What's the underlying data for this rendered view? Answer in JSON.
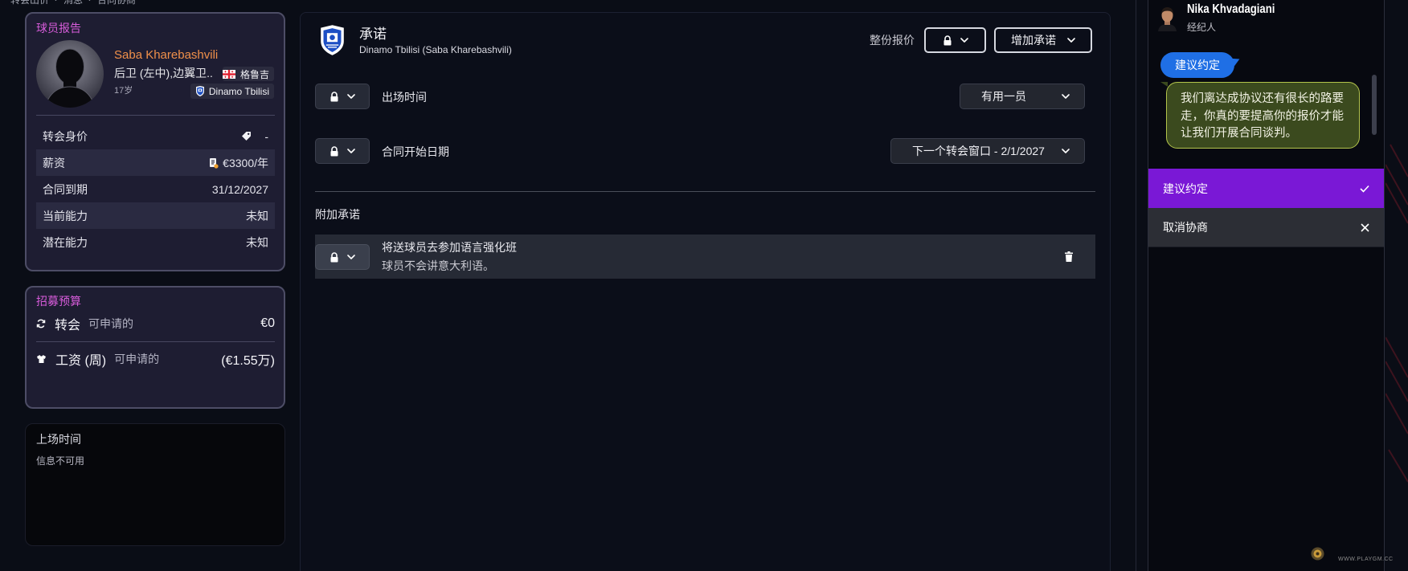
{
  "breadcrumb": [
    "转会出价",
    "消息",
    "合同协商"
  ],
  "breadcrumb_separator": "›",
  "player_report": {
    "title": "球员报告",
    "name": "Saba Kharebashvili",
    "position": "后卫 (左中),边翼卫..",
    "nationality": "格鲁吉",
    "age": "17岁",
    "club": "Dinamo Tbilisi",
    "rows": [
      {
        "label": "转会身价",
        "value": "-",
        "icon": "tag-icon"
      },
      {
        "label": "薪资",
        "value": "€3300/年",
        "icon": "contract-icon"
      },
      {
        "label": "合同到期",
        "value": "31/12/2027"
      },
      {
        "label": "当前能力",
        "value": "未知"
      },
      {
        "label": "潜在能力",
        "value": "未知"
      }
    ]
  },
  "budget": {
    "title": "招募预算",
    "transfer": {
      "label": "转会",
      "sub": "可申请的",
      "value": "€0",
      "icon": "refresh-icon"
    },
    "wage": {
      "label": "工资 (周)",
      "sub": "可申请的",
      "value": "(€1.55万)",
      "icon": "shirt-icon"
    }
  },
  "playing_time_card": {
    "title": "上场时间",
    "text": "信息不可用"
  },
  "promises": {
    "title": "承诺",
    "subtitle": "Dinamo Tbilisi (Saba Kharebashvili)",
    "whole_offer_label": "整份报价",
    "add_button": "增加承诺",
    "rows": [
      {
        "label": "出场时间",
        "value": "有用一员"
      },
      {
        "label": "合同开始日期",
        "value": "下一个转会窗口 - 2/1/2027"
      }
    ],
    "additional_title": "附加承诺",
    "additional": [
      {
        "title": "将送球员去参加语言强化班",
        "desc": "球员不会讲意大利语。"
      }
    ]
  },
  "agent": {
    "name": "Nika Khvadagiani",
    "role": "经纪人",
    "messages": [
      {
        "from": "user",
        "text": "建议约定"
      },
      {
        "from": "agent",
        "text": "我们离达成协议还有很长的路要走，你真的要提高你的报价才能让我们开展合同谈判。"
      }
    ],
    "options": [
      {
        "label": "建议约定",
        "icon": "check-icon",
        "selected": true
      },
      {
        "label": "取消协商",
        "icon": "close-icon",
        "selected": false
      }
    ]
  },
  "watermark": "WWW.PLAYGM.CC",
  "colors": {
    "bg": "#0a0d16",
    "card_bg": "#1e1d32",
    "title_pink": "#d65cd9",
    "name_orange": "#f0904a",
    "accent_purple": "#7a18d6",
    "bubble_blue": "#1f6fe5",
    "bubble_green_border": "#b3c44c"
  }
}
